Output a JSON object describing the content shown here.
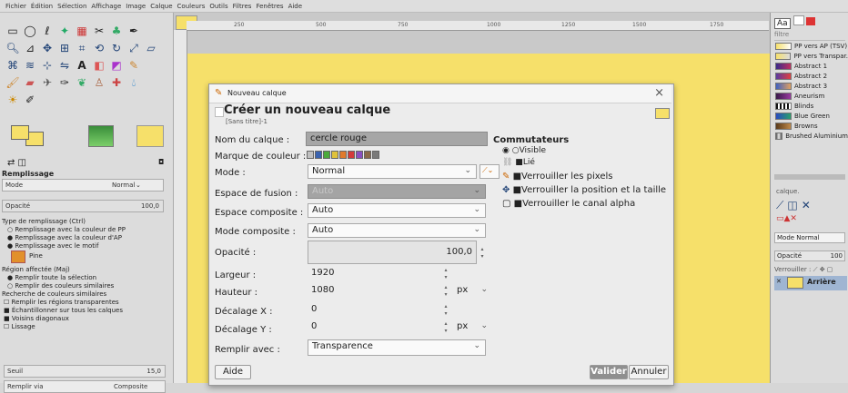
{
  "menubar": [
    "Fichier",
    "Édition",
    "Sélection",
    "Affichage",
    "Image",
    "Calque",
    "Couleurs",
    "Outils",
    "Filtres",
    "Fenêtres",
    "Aide"
  ],
  "ruler": [
    "250",
    "500",
    "750",
    "1000",
    "1250",
    "1500",
    "1750"
  ],
  "toolbox": {
    "section_title": "Remplissage",
    "mode_label": "Mode",
    "mode_value": "Normal",
    "opacity_label": "Opacité",
    "opacity_value": "100,0",
    "fill_type_heading": "Type de remplissage  (Ctrl)",
    "fill_fg": "Remplissage avec la couleur de PP",
    "fill_bg": "Remplissage avec la couleur d'AP",
    "fill_pattern": "Remplissage avec le motif",
    "pattern_name": "Pine",
    "affected_heading": "Région affectée  (Maj)",
    "affect_selection": "Remplir toute la sélection",
    "affect_similar": "Remplir des couleurs similaires",
    "search_heading": "Recherche de couleurs similaires",
    "transparent": "Remplir les régions transparentes",
    "sample_merged": "Échantillonner sur tous les calques",
    "diagonal": "Voisins diagonaux",
    "antialias": "Lissage",
    "threshold_label": "Seuil",
    "threshold_value": "15,0",
    "fill_by_label": "Remplir via",
    "fill_by_value": "Composite"
  },
  "rightdock": {
    "filter_label": "filtre",
    "brushes": [
      "PP vers AP (TSV)",
      "PP vers Transpar.",
      "Abstract 1",
      "Abstract 2",
      "Abstract 3",
      "Aneurism",
      "Blinds",
      "Blue Green",
      "Browns",
      "Brushed Aluminium"
    ],
    "layers_label": "calque.",
    "mode_label": "Mode Normal",
    "opacity_label": "Opacité",
    "opacity_value": "100",
    "lock_label": "Verrouiller :",
    "layer_name": "Arrière"
  },
  "dialog": {
    "window_title": "Nouveau calque",
    "heading": "Créer un nouveau calque",
    "subheading": "[Sans titre]-1",
    "name_label": "Nom du calque :",
    "name_value": "cercle rouge",
    "color_tag_label": "Marque de couleur :",
    "mode_label": "Mode :",
    "mode_value": "Normal",
    "blend_label": "Espace de fusion :",
    "blend_value": "Auto",
    "composite_space_label": "Espace composite :",
    "composite_space_value": "Auto",
    "composite_mode_label": "Mode composite :",
    "composite_mode_value": "Auto",
    "opacity_label": "Opacité :",
    "opacity_value": "100,0",
    "width_label": "Largeur :",
    "width_value": "1920",
    "height_label": "Hauteur :",
    "height_value": "1080",
    "unit": "px",
    "offx_label": "Décalage X :",
    "offx_value": "0",
    "offy_label": "Décalage Y :",
    "offy_value": "0",
    "fill_label": "Remplir avec :",
    "fill_value": "Transparence",
    "switches_heading": "Commutateurs",
    "visible": "Visible",
    "linked": "Lié",
    "lock_pixels": "Verrouiller les pixels",
    "lock_position": "Verrouiller la position et la taille",
    "lock_alpha": "Verrouiller le canal alpha",
    "help": "Aide",
    "ok": "Valider",
    "cancel": "Annuler",
    "close": "×"
  },
  "colors": {
    "canvas": "#f6e06a",
    "tags": [
      "#c0c0c0",
      "#3a63b0",
      "#4caa3c",
      "#e0c23a",
      "#e07a2c",
      "#d43a3a",
      "#8a4fc0",
      "#8a6a4a",
      "#7a7a7a"
    ]
  }
}
